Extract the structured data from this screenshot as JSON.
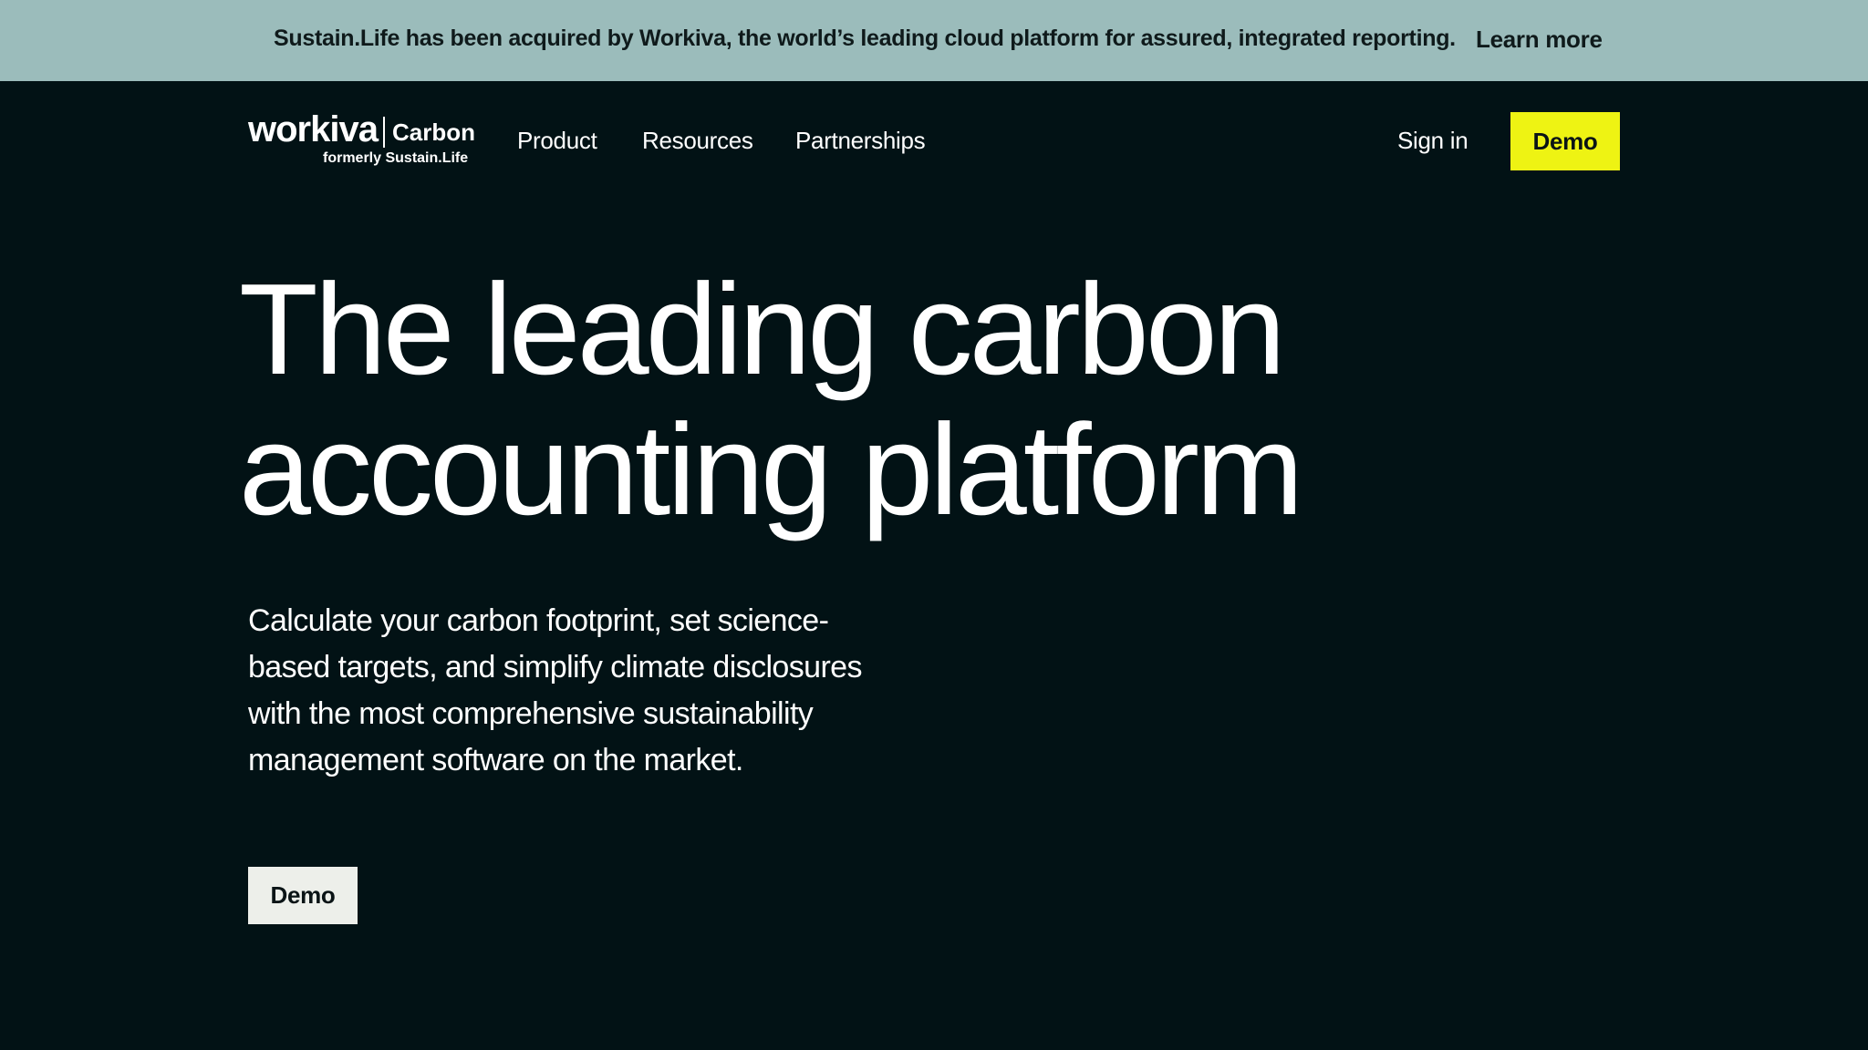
{
  "announcement": {
    "text": "Sustain.Life has been acquired by Workiva, the world’s leading cloud platform for assured, integrated reporting.",
    "link_label": "Learn more"
  },
  "header": {
    "logo": {
      "wordmark": "workiva",
      "product": "Carbon",
      "subtitle": "formerly Sustain.Life"
    },
    "nav": {
      "product": "Product",
      "resources": "Resources",
      "partnerships": "Partnerships"
    },
    "sign_in_label": "Sign in",
    "demo_label": "Demo"
  },
  "hero": {
    "title_line1": "The leading carbon",
    "title_line2": "accounting platform",
    "subtitle": "Calculate your carbon footprint, set science-based targets, and simplify climate disclosures with the most comprehensive sustainability management software on the market.",
    "cta_label": "Demo"
  },
  "colors": {
    "background": "#021215",
    "announcement_bg": "#9bbcbb",
    "accent_yellow": "#eef313",
    "secondary_button_bg": "#edefea"
  }
}
